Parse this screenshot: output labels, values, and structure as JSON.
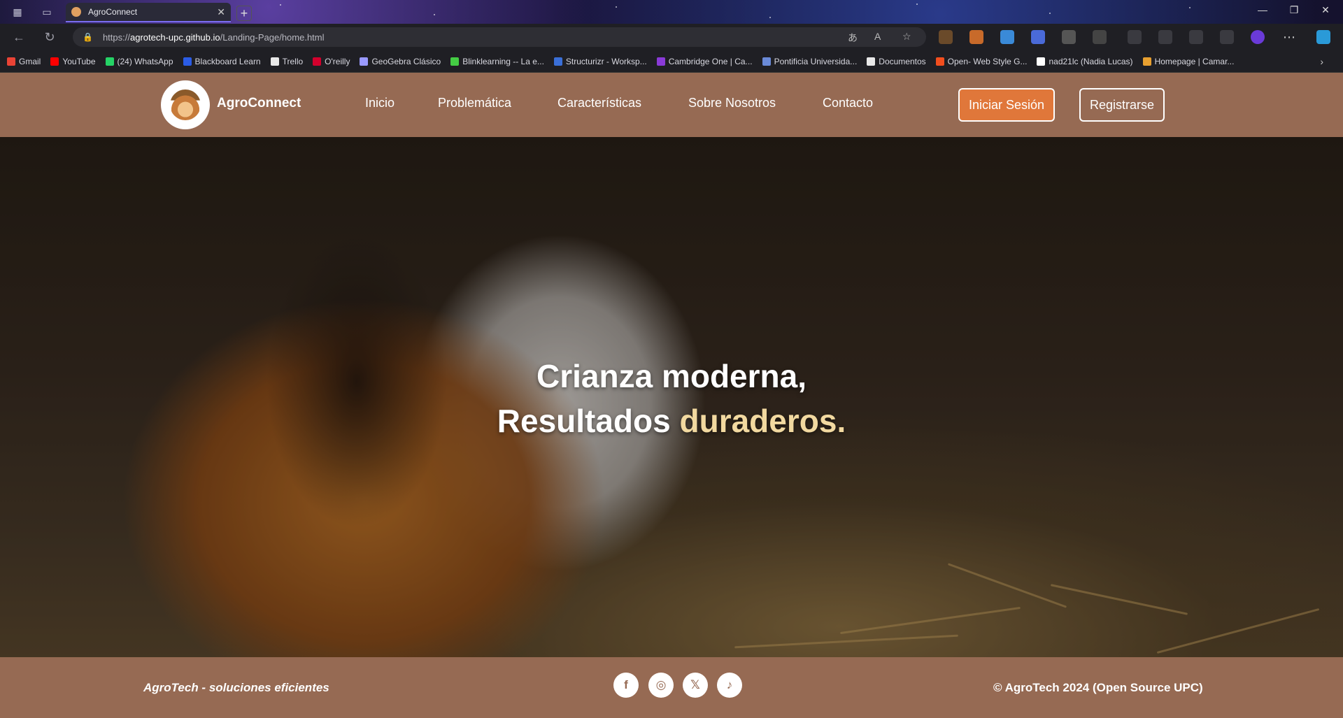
{
  "browser": {
    "tab_title": "AgroConnect",
    "url_prefix": "https://",
    "url_host": "agrotech-upc.github.io",
    "url_path": "/Landing-Page/home.html",
    "bookmarks": [
      {
        "label": "Gmail",
        "color": "#ea4335"
      },
      {
        "label": "YouTube",
        "color": "#ff0000"
      },
      {
        "label": "(24) WhatsApp",
        "color": "#25d366"
      },
      {
        "label": "Blackboard Learn",
        "color": "#2b5ce6"
      },
      {
        "label": "Trello",
        "color": "#e8e8e8"
      },
      {
        "label": "O'reilly",
        "color": "#d3002d"
      },
      {
        "label": "GeoGebra Clásico",
        "color": "#9999ff"
      },
      {
        "label": "Blinklearning -- La e...",
        "color": "#44cc44"
      },
      {
        "label": "Structurizr - Worksp...",
        "color": "#3a6fd8"
      },
      {
        "label": "Cambridge One | Ca...",
        "color": "#8a3ad8"
      },
      {
        "label": "Pontificia Universida...",
        "color": "#6a8ad8"
      },
      {
        "label": "Documentos",
        "color": "#e8e8e8"
      },
      {
        "label": "Open- Web Style G...",
        "color": "#f24e1e"
      },
      {
        "label": "nad21lc (Nadia Lucas)",
        "color": "#ffffff"
      },
      {
        "label": "Homepage | Camar...",
        "color": "#e8a030"
      }
    ]
  },
  "header": {
    "brand": "AgroConnect",
    "menu": [
      "Inicio",
      "Problemática",
      "Características",
      "Sobre Nosotros",
      "Contacto"
    ],
    "login_label": "Iniciar Sesión",
    "register_label": "Registrarse"
  },
  "hero": {
    "line1": "Crianza moderna,",
    "line2_a": "Resultados ",
    "line2_b": "duraderos."
  },
  "footer": {
    "left": "AgroTech - soluciones eficientes",
    "right": "© AgroTech 2024 (Open Source UPC)",
    "social": [
      {
        "icon": "facebook-icon",
        "glyph": "f"
      },
      {
        "icon": "instagram-icon",
        "glyph": "◎"
      },
      {
        "icon": "x-icon",
        "glyph": "𝕏"
      },
      {
        "icon": "tiktok-icon",
        "glyph": "♪"
      }
    ]
  },
  "colors": {
    "header_bg": "#966a53",
    "login_bg": "#e0773a",
    "hero_accent": "#f2d9a0"
  }
}
